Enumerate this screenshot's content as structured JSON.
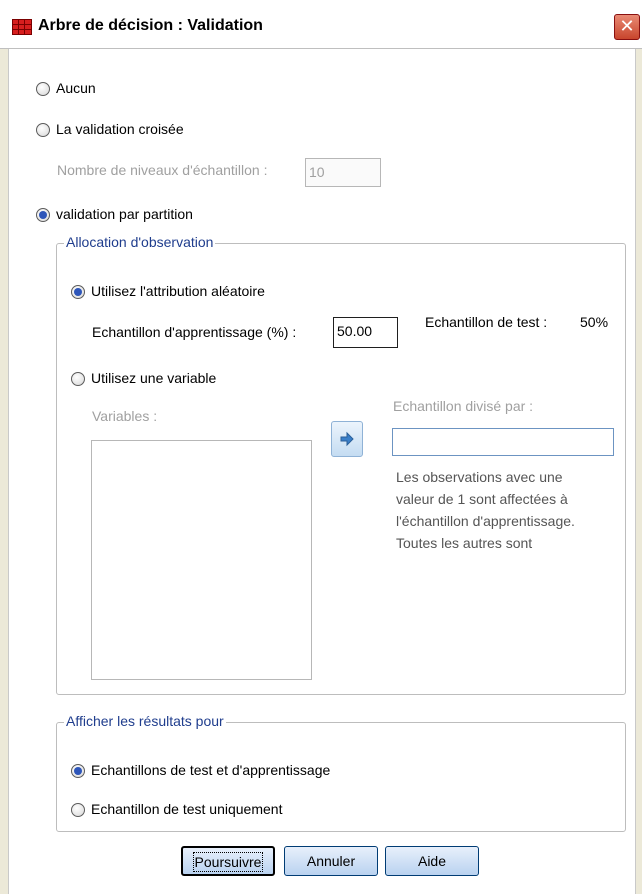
{
  "window": {
    "title": "Arbre de décision : Validation",
    "close_glyph": "✕"
  },
  "options": {
    "none": "Aucun",
    "cross_validation": "La validation croisée",
    "folds_label": "Nombre de niveaux d'échantillon :",
    "folds_value": "10",
    "split_sample": "validation par partition"
  },
  "allocation": {
    "legend": "Allocation d'observation",
    "random": "Utilisez l'attribution aléatoire",
    "training_label": "Echantillon d'apprentissage (%) :",
    "training_value": "50.00",
    "test_label": "Echantillon de test :",
    "test_value": "50%",
    "use_variable": "Utilisez une variable",
    "variables_label": "Variables :",
    "split_by_label": "Echantillon divisé par :",
    "split_by_value": "",
    "note": [
      "Les observations avec une",
      "valeur de 1 sont affectées à",
      "l'échantillon d'apprentissage.",
      "Toutes les autres sont"
    ]
  },
  "display": {
    "legend": "Afficher les résultats pour",
    "both": "Echantillons de test et d'apprentissage",
    "test_only": "Echantillon de test uniquement"
  },
  "buttons": {
    "continue": "Poursuivre",
    "cancel": "Annuler",
    "help": "Aide"
  }
}
